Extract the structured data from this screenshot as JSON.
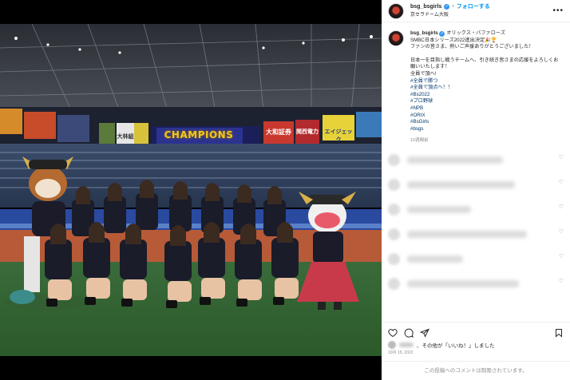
{
  "photo": {
    "scoreboard": "CHAMPIONS",
    "ads": [
      "大和証券",
      "関西電力",
      "大林組",
      "エイジェック"
    ]
  },
  "header": {
    "username": "bsg_bsgirls",
    "follow_label": "フォローする",
    "location": "京セラドーム大阪",
    "more_label": "•••"
  },
  "caption": {
    "username": "bsg_bsgirls",
    "text_line1": "オリックス・バファローズ",
    "text_line2": "SMBC日本シリーズ2022進出決定🎉🏆",
    "text_line3": "ファンの皆さま、熱いご声援ありがとうございました！",
    "text_line4": "日本一を目指し戦うチームへ、引き続き皆さまの応援をよろしくお願いいたします！",
    "text_line5": "全員で頂へ!",
    "hashtags": [
      "#全員で勝つ",
      "#全員で頂点へ！！",
      "#Bs2022",
      "#プロ野球",
      "#NPB",
      "#ORIX",
      "#BsGirls",
      "#bsgs"
    ],
    "ago": "10週間前"
  },
  "likes": {
    "suffix": "、その他が「いいね！」しました"
  },
  "date": "10月 15, 2022",
  "login_note": "この投稿へのコメントは制限されています。",
  "colors": {
    "link": "#0095f6",
    "hashtag": "#00376b",
    "muted": "#8e8e8e"
  },
  "icons": [
    "heart-icon",
    "comment-icon",
    "share-icon",
    "bookmark-icon"
  ]
}
